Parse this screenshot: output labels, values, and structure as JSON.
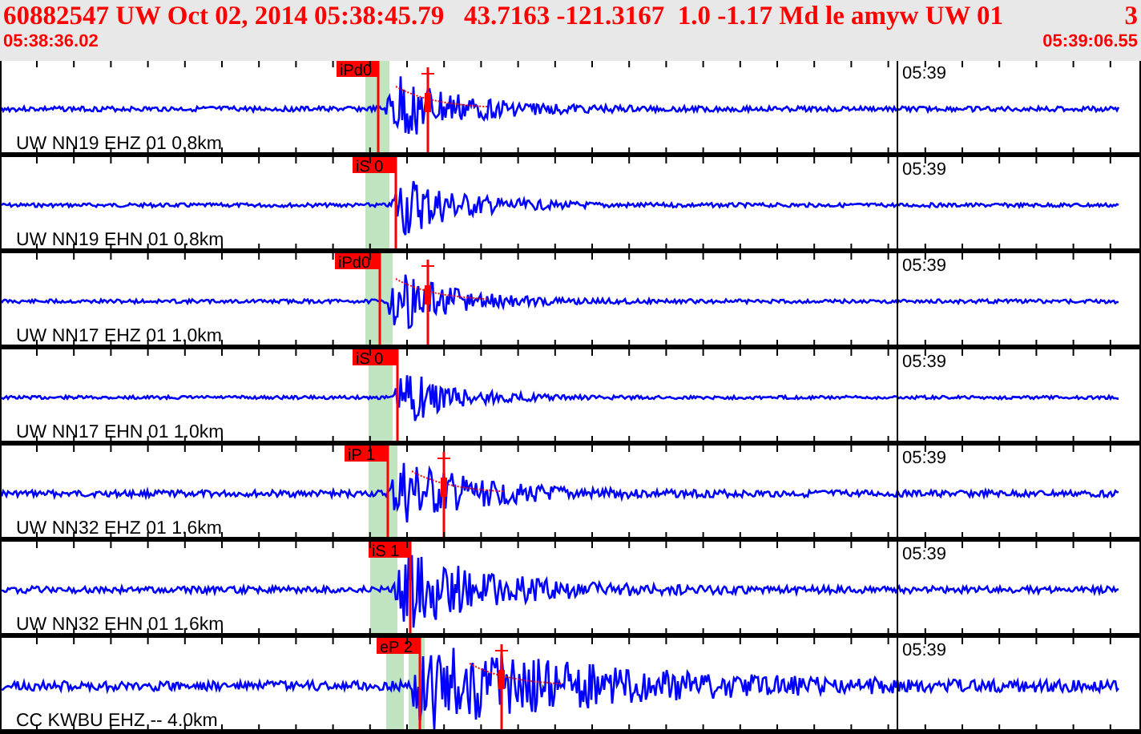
{
  "header": {
    "title": "60882547 UW Oct 02, 2014 05:38:45.79   43.7163 -121.3167  1.0 -1.17 Md le amyw UW 01",
    "count": "3",
    "start_time": "05:38:36.02",
    "end_time": "05:39:06.55"
  },
  "traces": [
    {
      "label": "UW NN19 EHZ 01 0.8km",
      "time_mark": "05:39",
      "picks": [
        {
          "label": "iPd0"
        }
      ]
    },
    {
      "label": "UW NN19 EHN 01 0.8km",
      "time_mark": "05:39",
      "picks": [
        {
          "label": "iS 0"
        }
      ]
    },
    {
      "label": "UW NN17 EHZ 01 1.0km",
      "time_mark": "05:39",
      "picks": [
        {
          "label": "iPd0"
        }
      ]
    },
    {
      "label": "UW NN17 EHN 01 1.0km",
      "time_mark": "05:39",
      "picks": [
        {
          "label": "iS 0"
        }
      ]
    },
    {
      "label": "UW NN32 EHZ 01 1.6km",
      "time_mark": "05:39",
      "picks": [
        {
          "label": "iP 1"
        }
      ]
    },
    {
      "label": "UW NN32 EHN 01 1.6km",
      "time_mark": "05:39",
      "picks": [
        {
          "label": "iS 1"
        }
      ]
    },
    {
      "label": "CC KWBU EHZ -- 4.0km",
      "time_mark": "05:39",
      "picks": [
        {
          "label": "eP 2"
        }
      ]
    }
  ]
}
